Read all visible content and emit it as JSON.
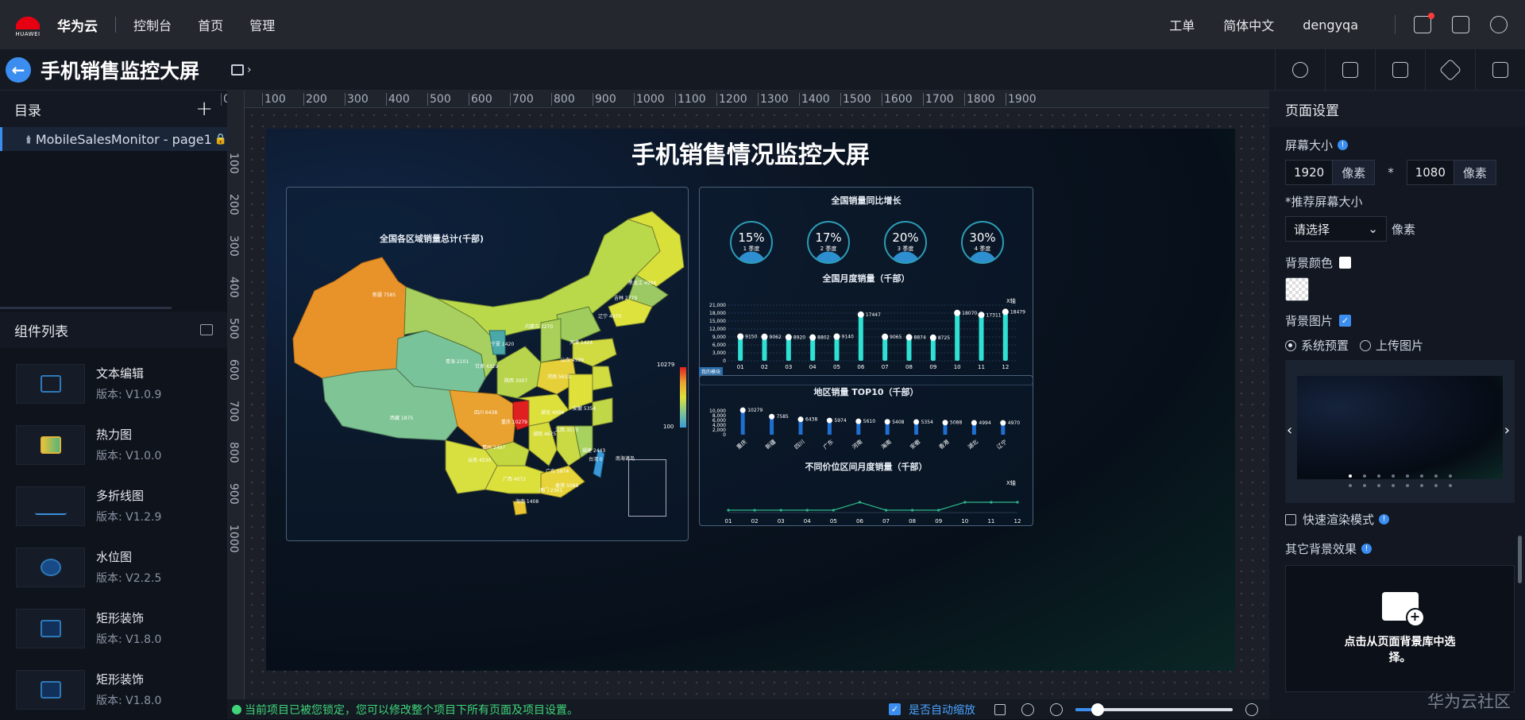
{
  "topbar": {
    "brand": "华为云",
    "logo_text": "HUAWEI",
    "nav": [
      "控制台",
      "首页",
      "管理"
    ],
    "ticket": "工单",
    "language": "简体中文",
    "user": "dengyqa"
  },
  "toolbar": {
    "title": "手机销售监控大屏"
  },
  "catalog": {
    "title": "目录",
    "page": "MobileSalesMonitor - page1"
  },
  "components": {
    "title": "组件列表",
    "items": [
      {
        "name": "文本编辑",
        "version": "版本: V1.0.9"
      },
      {
        "name": "热力图",
        "version": "版本: V1.0.0"
      },
      {
        "name": "多折线图",
        "version": "版本: V1.2.9"
      },
      {
        "name": "水位图",
        "version": "版本: V2.2.5"
      },
      {
        "name": "矩形装饰",
        "version": "版本: V1.8.0"
      },
      {
        "name": "矩形装饰",
        "version": "版本: V1.8.0"
      }
    ]
  },
  "ruler": {
    "h": [
      "0",
      "100",
      "200",
      "300",
      "400",
      "500",
      "600",
      "700",
      "800",
      "900",
      "1000",
      "1100",
      "1200",
      "1300",
      "1400",
      "1500",
      "1600",
      "1700",
      "1800",
      "1900"
    ],
    "v": [
      "100",
      "200",
      "300",
      "400",
      "500",
      "600",
      "700",
      "800",
      "900",
      "1000"
    ]
  },
  "screen": {
    "title": "手机销售情况监控大屏",
    "map": {
      "title": "全国各区域销量总计(千部)",
      "legend_max": "10279",
      "legend_min": "100",
      "inset_label": "南海诸岛",
      "regions": [
        {
          "name": "新疆",
          "value": "7585"
        },
        {
          "name": "西藏",
          "value": "1875"
        },
        {
          "name": "青海",
          "value": "2101"
        },
        {
          "name": "甘肃",
          "value": "4329"
        },
        {
          "name": "内蒙古",
          "value": "3270"
        },
        {
          "name": "黑龙江",
          "value": "4994"
        },
        {
          "name": "吉林",
          "value": "2779"
        },
        {
          "name": "辽宁",
          "value": "4970"
        },
        {
          "name": "宁夏",
          "value": "1420"
        },
        {
          "name": "陕西",
          "value": "3007"
        },
        {
          "name": "四川",
          "value": "6438"
        },
        {
          "name": "重庆",
          "value": "10279"
        },
        {
          "name": "云南",
          "value": "4530"
        },
        {
          "name": "贵州",
          "value": "2497"
        },
        {
          "name": "广西",
          "value": "4072"
        },
        {
          "name": "广东",
          "value": "5974"
        },
        {
          "name": "湖南",
          "value": "4675"
        },
        {
          "name": "湖北",
          "value": "4994"
        },
        {
          "name": "江西",
          "value": "3573"
        },
        {
          "name": "福建",
          "value": "2443"
        },
        {
          "name": "河南",
          "value": "5610"
        },
        {
          "name": "山东",
          "value": "4599"
        },
        {
          "name": "安徽",
          "value": "5354"
        },
        {
          "name": "海南",
          "value": "1408"
        },
        {
          "name": "澳门",
          "value": "2361"
        },
        {
          "name": "香港",
          "value": "5088"
        },
        {
          "name": "台湾",
          "value": "0"
        },
        {
          "name": "天津",
          "value": "1424"
        }
      ]
    },
    "growth": {
      "title": "全国销量同比增长",
      "items": [
        {
          "pct": "15%",
          "label": "1 季度"
        },
        {
          "pct": "17%",
          "label": "2 季度"
        },
        {
          "pct": "20%",
          "label": "3 季度"
        },
        {
          "pct": "30%",
          "label": "4 季度"
        }
      ]
    },
    "monthly": {
      "title": "全国月度销量（千部）",
      "legend": "X轴",
      "yticks": [
        "21,000",
        "18,000",
        "15,000",
        "12,000",
        "9,000",
        "6,000",
        "3,000",
        "0"
      ]
    },
    "top10": {
      "title": "地区销量 TOP10（千部）",
      "tag": "我的模块",
      "yticks": [
        "10,000",
        "8,000",
        "6,000",
        "4,000",
        "2,000",
        "0"
      ]
    },
    "price": {
      "title": "不同价位区间月度销量（千部）",
      "legend": "X轴"
    }
  },
  "chart_data": [
    {
      "type": "bar",
      "title": "全国月度销量（千部）",
      "categories": [
        "01",
        "02",
        "03",
        "04",
        "05",
        "06",
        "07",
        "08",
        "09",
        "10",
        "11",
        "12"
      ],
      "values": [
        9150,
        9062,
        8920,
        8802,
        9140,
        17447,
        9065,
        8874,
        8725,
        18070,
        17311,
        18479
      ],
      "ylim": [
        0,
        21000
      ]
    },
    {
      "type": "bar",
      "title": "地区销量 TOP10（千部）",
      "categories": [
        "重庆",
        "新疆",
        "四川",
        "广东",
        "河南",
        "海南",
        "安徽",
        "香港",
        "湖北",
        "辽宁"
      ],
      "values": [
        10279,
        7585,
        6438,
        5974,
        5610,
        5408,
        5354,
        5088,
        4994,
        4970
      ],
      "ylim": [
        0,
        10000
      ]
    },
    {
      "type": "line",
      "title": "不同价位区间月度销量（千部）",
      "categories": [
        "01",
        "02",
        "03",
        "04",
        "05",
        "06",
        "07",
        "08",
        "09",
        "10",
        "11",
        "12"
      ],
      "values": [
        2,
        2,
        2,
        2,
        2,
        3,
        2,
        2,
        2,
        3,
        3,
        3
      ]
    }
  ],
  "bottombar": {
    "lock_msg": "当前项目已被您锁定，您可以修改整个项目下所有页面及项目设置。",
    "autozoom": "是否自动缩放",
    "zoom": 0.14
  },
  "settings": {
    "title": "页面设置",
    "screen_size": "屏幕大小",
    "width": "1920",
    "height": "1080",
    "unit": "像素",
    "times": "*",
    "recommend": "*推荐屏幕大小",
    "select_placeholder": "请选择",
    "bg_color": "背景颜色",
    "bg_image": "背景图片",
    "preset": "系统预置",
    "upload": "上传图片",
    "fast_render": "快速渲染模式",
    "other_effects": "其它背景效果",
    "pick_text": "点击从页面背景库中选择。",
    "watermark": "华为云社区"
  }
}
